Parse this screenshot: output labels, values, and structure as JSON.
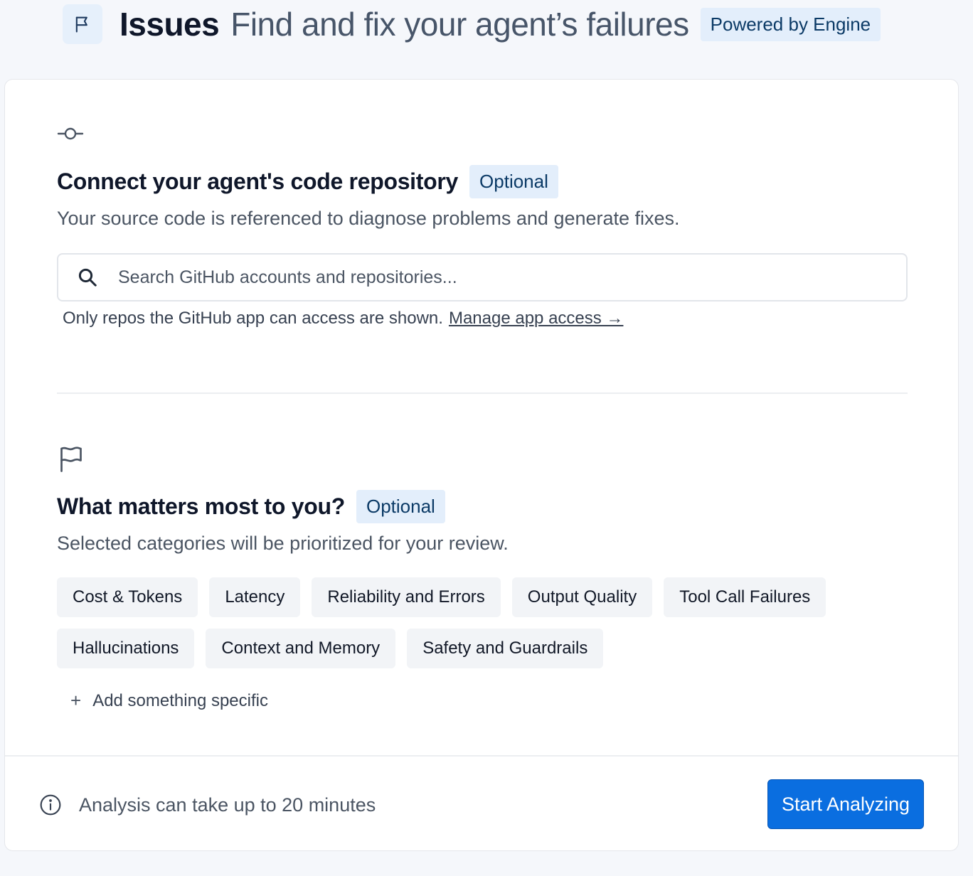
{
  "header": {
    "title": "Issues",
    "subtitle": "Find and fix your agent’s failures",
    "badge": "Powered by Engine",
    "icon": "flag-icon"
  },
  "repo_section": {
    "icon": "git-commit-icon",
    "title": "Connect your agent's code repository",
    "badge": "Optional",
    "description": "Your source code is referenced to diagnose problems and generate fixes.",
    "search": {
      "placeholder": "Search GitHub accounts and repositories...",
      "value": ""
    },
    "help_text": "Only repos the GitHub app can access are shown.",
    "manage_link": "Manage app access →"
  },
  "priority_section": {
    "icon": "flag-icon",
    "title": "What matters most to you?",
    "badge": "Optional",
    "description": "Selected categories will be prioritized for your review.",
    "categories": [
      "Cost & Tokens",
      "Latency",
      "Reliability and Errors",
      "Output Quality",
      "Tool Call Failures",
      "Hallucinations",
      "Context and Memory",
      "Safety and Guardrails"
    ],
    "add_specific": "Add something specific"
  },
  "footer": {
    "info_icon": "info-icon",
    "note": "Analysis can take up to 20 minutes",
    "start_button": "Start Analyzing"
  },
  "colors": {
    "accent": "#0a6ee0",
    "badge_bg": "#e3eefb",
    "badge_text": "#0b3a66",
    "chip_bg": "#f2f4f7",
    "page_bg": "#f5f7fb"
  }
}
